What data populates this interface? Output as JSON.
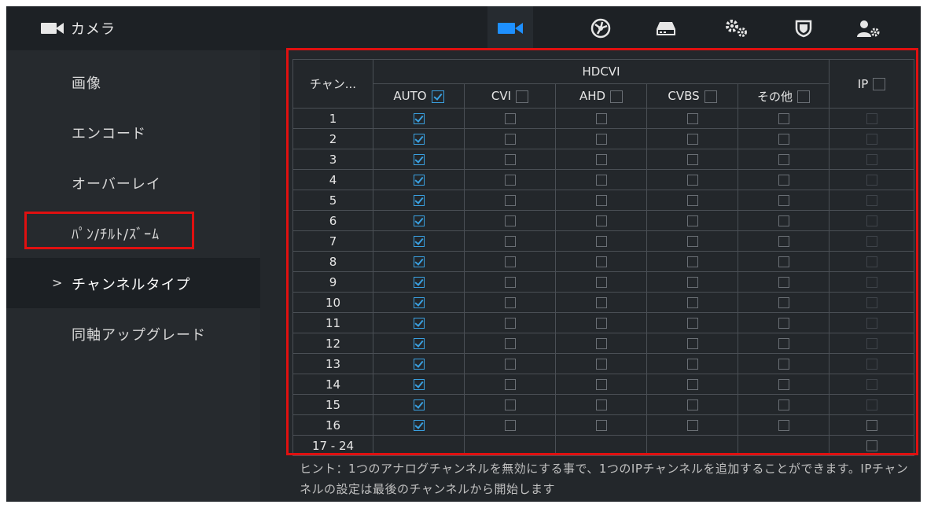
{
  "app": {
    "title": "カメラ"
  },
  "top_nav": {
    "icons": [
      "camera-icon",
      "network-icon",
      "storage-icon",
      "system-icon",
      "security-icon",
      "account-icon"
    ],
    "active_color": "#1e90ff"
  },
  "sidebar": {
    "items": [
      {
        "label": "画像"
      },
      {
        "label": "エンコード"
      },
      {
        "label": "オーバーレイ"
      },
      {
        "label": "ﾊﾟﾝ/ﾁﾙﾄ/ｽﾞｰﾑ"
      },
      {
        "label": "チャンネルタイプ",
        "active": true,
        "marker": ">"
      },
      {
        "label": "同軸アップグレード"
      }
    ]
  },
  "table": {
    "channel_header": "チャン...",
    "group_header": "HDCVI",
    "columns": [
      "AUTO",
      "CVI",
      "AHD",
      "CVBS",
      "その他",
      "IP"
    ],
    "header_checks": {
      "AUTO": true,
      "CVI": false,
      "AHD": false,
      "CVBS": false,
      "その他": false,
      "IP": false
    },
    "rows": [
      {
        "channel": "1",
        "auto": true
      },
      {
        "channel": "2",
        "auto": true
      },
      {
        "channel": "3",
        "auto": true
      },
      {
        "channel": "4",
        "auto": true
      },
      {
        "channel": "5",
        "auto": true
      },
      {
        "channel": "6",
        "auto": true
      },
      {
        "channel": "7",
        "auto": true
      },
      {
        "channel": "8",
        "auto": true
      },
      {
        "channel": "9",
        "auto": true
      },
      {
        "channel": "10",
        "auto": true
      },
      {
        "channel": "11",
        "auto": true
      },
      {
        "channel": "12",
        "auto": true
      },
      {
        "channel": "13",
        "auto": true
      },
      {
        "channel": "14",
        "auto": true
      },
      {
        "channel": "15",
        "auto": true
      },
      {
        "channel": "16",
        "auto": true,
        "ip_enabled": true
      }
    ],
    "extra_row": {
      "channel": "17 - 24"
    }
  },
  "hint": "ヒント：1つのアナログチャンネルを無効にする事で、1つのIPチャンネルを追加することができます。IPチャンネルの設定は最後のチャンネルから開始します",
  "colors": {
    "highlight_red": "#e01010",
    "check_blue": "#3aa0e0",
    "background": "#262a2e"
  }
}
